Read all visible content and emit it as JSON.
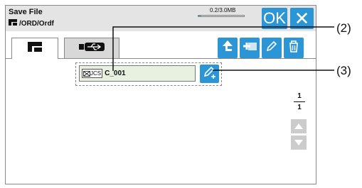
{
  "header": {
    "title": "Save File",
    "path": "/ORD/Ordf",
    "capacity": "0.2/3.0MB",
    "capacity_used_fraction": 0.067,
    "ok_label": "OK",
    "close_label": "✕"
  },
  "tabs": [
    {
      "name": "machine-memory",
      "icon": "sewing-machine-icon",
      "selected": true
    },
    {
      "name": "usb",
      "icon": "usb-icon",
      "selected": false
    }
  ],
  "toolbar": [
    {
      "name": "up-folder-button",
      "icon": "up-arrow-icon"
    },
    {
      "name": "new-folder-button",
      "icon": "new-folder-icon"
    },
    {
      "name": "rename-button",
      "icon": "pencil-icon"
    },
    {
      "name": "delete-button",
      "icon": "trash-icon"
    }
  ],
  "file": {
    "badge": "JCS",
    "name": "C_001"
  },
  "pager": {
    "current": "1",
    "total": "1"
  },
  "callouts": {
    "c2": "(2)",
    "c3": "(3)"
  },
  "colors": {
    "accent": "#2b95d6",
    "titlebar": "#e4e4e4"
  }
}
